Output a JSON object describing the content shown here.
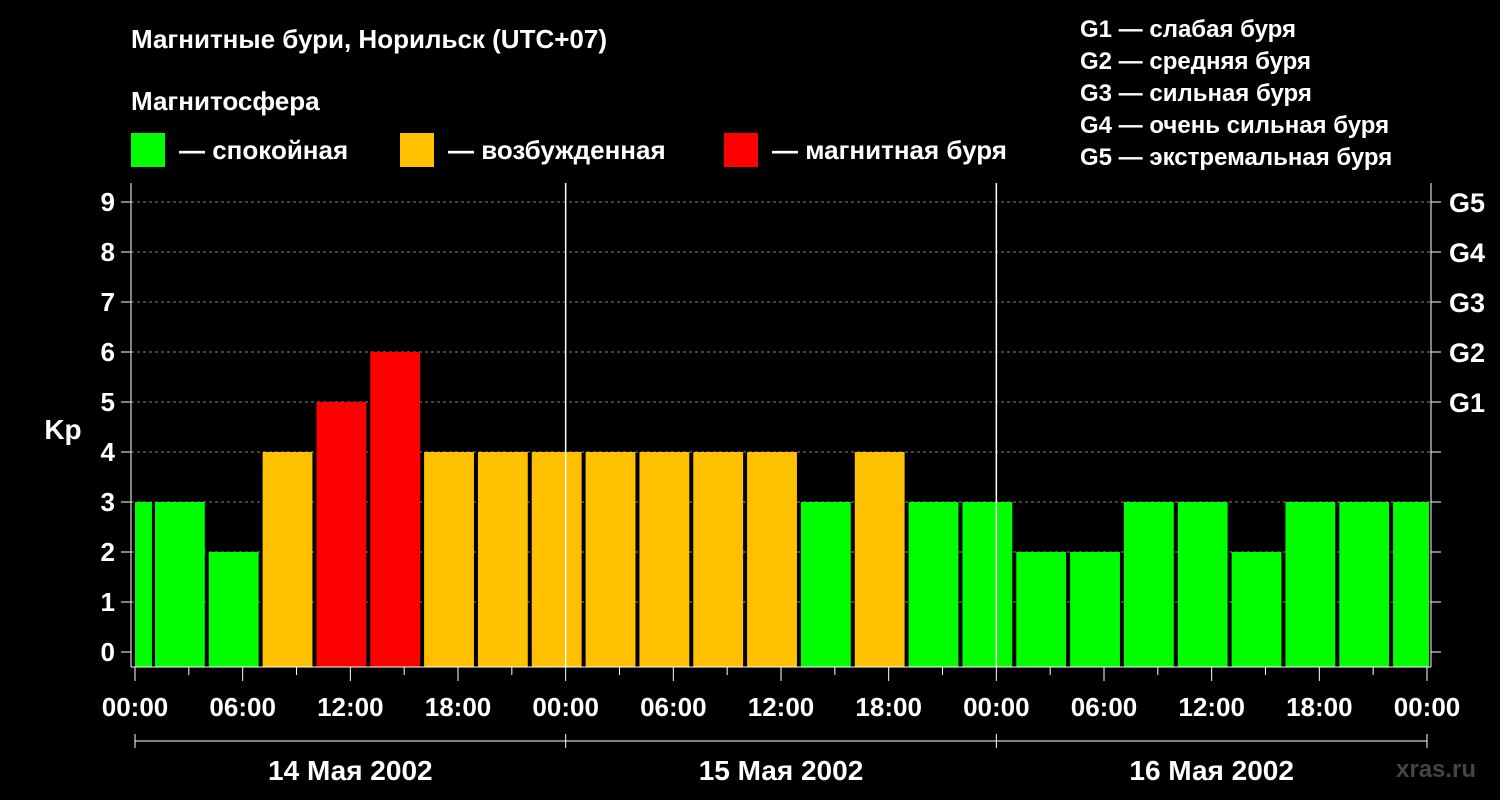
{
  "title": "Магнитные бури, Норильск (UTC+07)",
  "magnetosphere_label": "Магнитосфера",
  "legend": [
    {
      "label": "— спокойная",
      "color": "#00ff00"
    },
    {
      "label": "— возбужденная",
      "color": "#ffc000"
    },
    {
      "label": "— магнитная буря",
      "color": "#ff0000"
    }
  ],
  "g_legend": [
    "G1 — слабая буря",
    "G2 — средняя буря",
    "G3 — сильная буря",
    "G4 — очень сильная буря",
    "G5 — экстремальная буря"
  ],
  "watermark": "xras.ru",
  "chart_data": {
    "type": "bar",
    "ylabel": "Kp",
    "ylim": [
      0,
      9
    ],
    "yticks": [
      "0",
      "1",
      "2",
      "3",
      "4",
      "5",
      "6",
      "7",
      "8",
      "9"
    ],
    "right_ticks": [
      {
        "value": 5,
        "label": "G1"
      },
      {
        "value": 6,
        "label": "G2"
      },
      {
        "value": 7,
        "label": "G3"
      },
      {
        "value": 8,
        "label": "G4"
      },
      {
        "value": 9,
        "label": "G5"
      }
    ],
    "xticks": [
      "00:00",
      "06:00",
      "12:00",
      "18:00",
      "00:00",
      "06:00",
      "12:00",
      "18:00",
      "00:00",
      "06:00",
      "12:00",
      "18:00",
      "00:00"
    ],
    "dates": [
      "14 Мая 2002",
      "15 Мая 2002",
      "16 Мая 2002"
    ],
    "values": [
      3,
      3,
      2,
      4,
      5,
      6,
      4,
      4,
      4,
      4,
      4,
      4,
      4,
      3,
      4,
      3,
      3,
      2,
      2,
      3,
      3,
      2,
      3,
      3,
      3
    ],
    "colors": {
      "quiet": "#00ff00",
      "active": "#ffc000",
      "storm": "#ff0000"
    },
    "grid": true
  }
}
